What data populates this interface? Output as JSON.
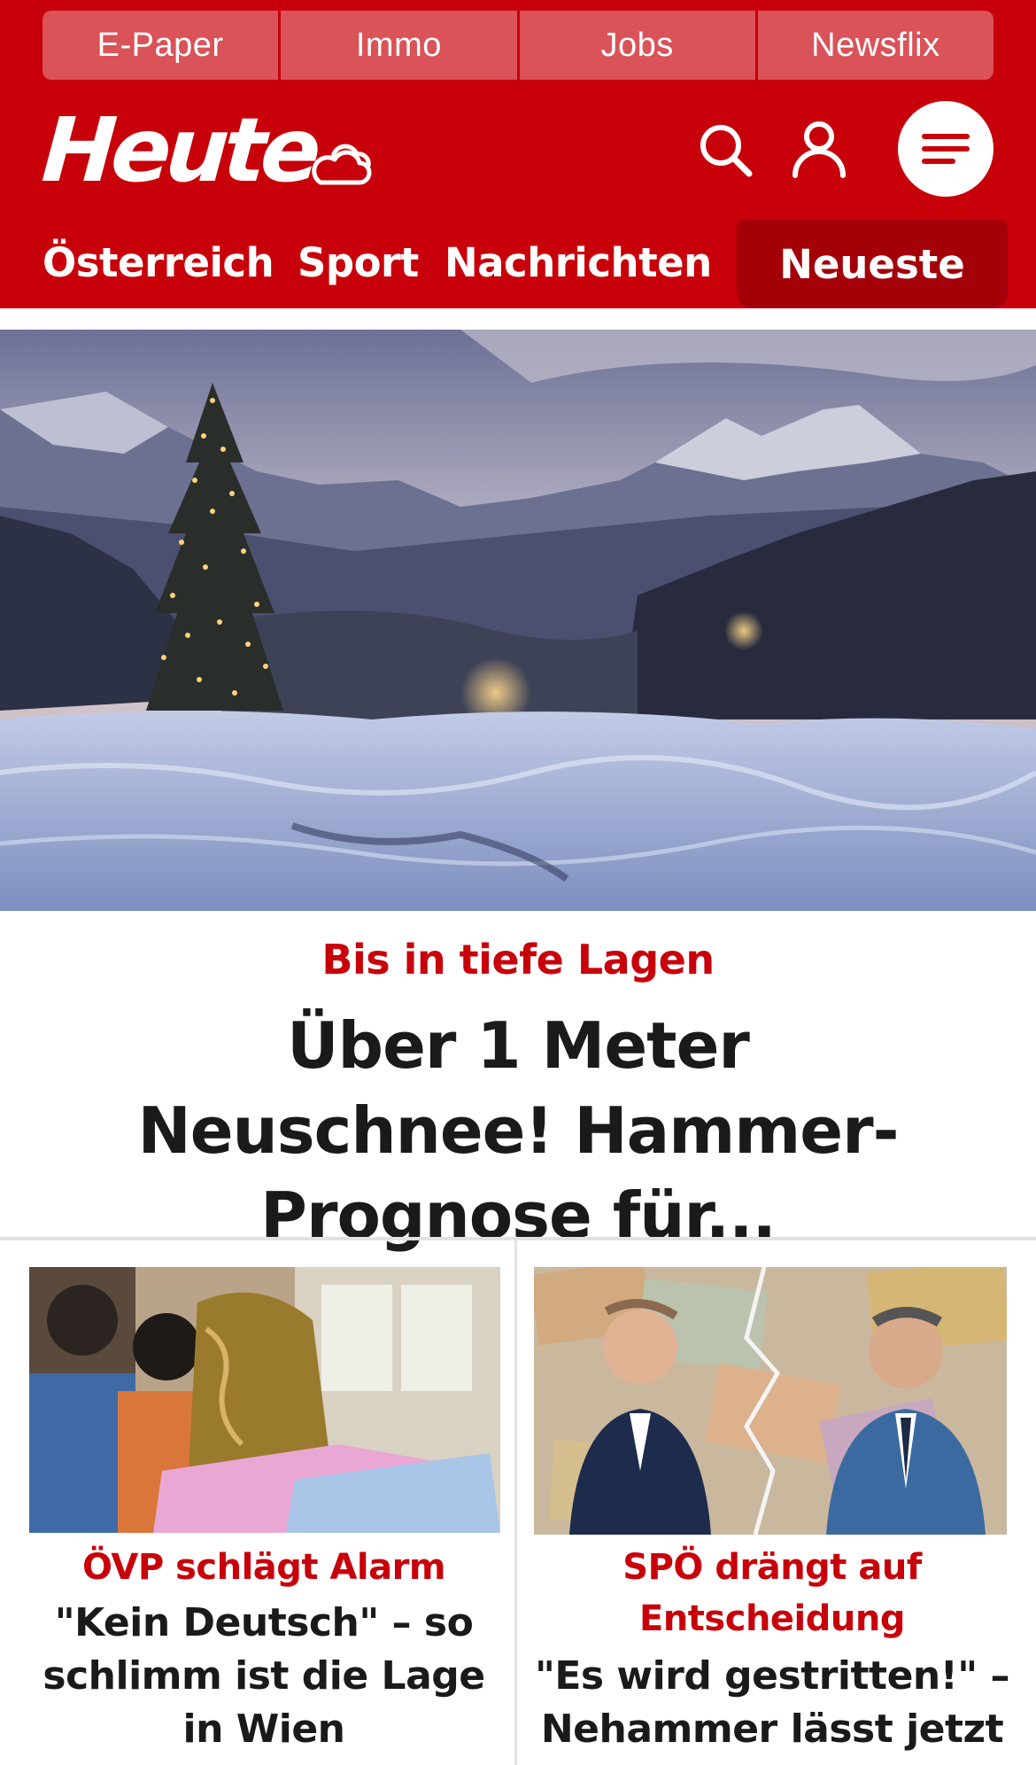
{
  "topbar": {
    "items": [
      "E-Paper",
      "Immo",
      "Jobs",
      "Newsflix"
    ]
  },
  "brand": {
    "logo": "Heute",
    "weather_icon": "cloud-sun-icon",
    "primary_color": "#c8000a",
    "active_tab_color": "#a3000a",
    "topbar_color": "#d95358"
  },
  "header_icons": [
    "search-icon",
    "user-icon",
    "menu-icon"
  ],
  "nav": {
    "items": [
      "Österreich",
      "Sport",
      "Nachrichten"
    ],
    "active": "Neueste"
  },
  "hero": {
    "image_description_icon": "snowy-mountain-christmas-tree-photo",
    "kicker": "Bis in tiefe Lagen",
    "headline": "Über 1 Meter Neuschnee! Hammer-Prognose für..."
  },
  "teasers": [
    {
      "image_icon": "schoolchildren-photo",
      "kicker": "ÖVP schlägt Alarm",
      "title": "\"Kein Deutsch\" – so schlimm ist die Lage in Wien"
    },
    {
      "image_icon": "politicians-money-photo",
      "kicker": "SPÖ drängt auf Entscheidung",
      "title": "\"Es wird gestritten!\" – Nehammer lässt jetzt"
    }
  ]
}
